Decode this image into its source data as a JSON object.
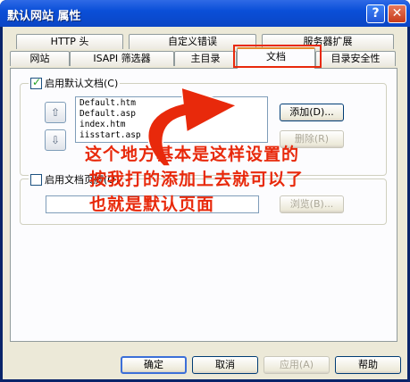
{
  "window": {
    "title": "默认网站 属性",
    "help_glyph": "?",
    "close_glyph": "✕"
  },
  "tabs_back": [
    "HTTP 头",
    "自定义错误",
    "服务器扩展"
  ],
  "tabs_front": [
    "网站",
    "ISAPI 筛选器",
    "主目录",
    "文档",
    "目录安全性"
  ],
  "documents": {
    "enable_default_label": "启用默认文档(C)",
    "enable_default_checked": true,
    "default_docs": [
      "Default.htm",
      "Default.asp",
      "index.htm",
      "iisstart.asp"
    ],
    "add_button": "添加(D)...",
    "remove_button": "删除(R)",
    "footer_label": "启用文档页脚(O)",
    "footer_checked": false,
    "browse_button": "浏览(B)..."
  },
  "annotation": {
    "line1": "这个地方基本是这样设置的",
    "line2": "按我打的添加上去就可以了",
    "line3": "也就是默认页面",
    "color": "#e8290b"
  },
  "buttons": {
    "ok": "确定",
    "cancel": "取消",
    "apply": "应用(A)",
    "help": "帮助"
  }
}
